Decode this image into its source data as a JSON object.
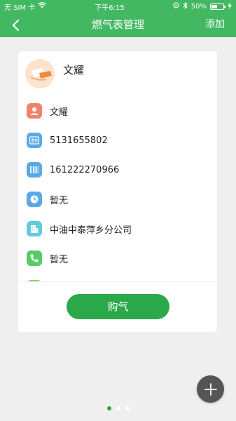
{
  "status_bar": {
    "carrier": "无 SIM 卡",
    "time": "下午6:15",
    "battery_percent": "50%",
    "battery_level": 0.5
  },
  "nav": {
    "title": "燃气表管理",
    "add_label": "添加",
    "back_icon": "chevron-left-icon"
  },
  "card": {
    "owner_name": "文耀",
    "items": [
      {
        "icon": "person-icon",
        "color": "#f0826a",
        "text": "文耀"
      },
      {
        "icon": "id-card-icon",
        "color": "#5aa9e6",
        "text": "5131655802"
      },
      {
        "icon": "barcode-icon",
        "color": "#5aa9e6",
        "text": "161222270966"
      },
      {
        "icon": "clock-icon",
        "color": "#5aa9e6",
        "text": "暂无"
      },
      {
        "icon": "building-icon",
        "color": "#5ecbe0",
        "text": "中油中泰萍乡分公司"
      },
      {
        "icon": "phone-icon",
        "color": "#59c96b",
        "text": "暂无"
      }
    ],
    "buy_label": "购气"
  },
  "fab_icon": "plus-icon",
  "pager": {
    "count": 3,
    "active": 0
  },
  "colors": {
    "brand": "#43b862",
    "button": "#2aa84a",
    "background": "#efefef"
  }
}
